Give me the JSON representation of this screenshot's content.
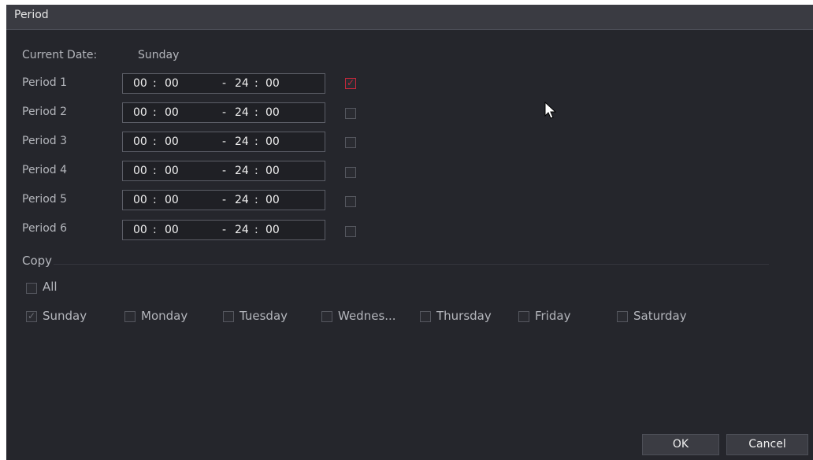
{
  "dialog": {
    "title": "Period"
  },
  "current_date": {
    "label": "Current Date:",
    "value": "Sunday"
  },
  "periods": [
    {
      "label": "Period 1",
      "start_h": "00",
      "start_m": "00",
      "end_h": "24",
      "end_m": "00",
      "enabled": true
    },
    {
      "label": "Period 2",
      "start_h": "00",
      "start_m": "00",
      "end_h": "24",
      "end_m": "00",
      "enabled": false
    },
    {
      "label": "Period 3",
      "start_h": "00",
      "start_m": "00",
      "end_h": "24",
      "end_m": "00",
      "enabled": false
    },
    {
      "label": "Period 4",
      "start_h": "00",
      "start_m": "00",
      "end_h": "24",
      "end_m": "00",
      "enabled": false
    },
    {
      "label": "Period 5",
      "start_h": "00",
      "start_m": "00",
      "end_h": "24",
      "end_m": "00",
      "enabled": false
    },
    {
      "label": "Period 6",
      "start_h": "00",
      "start_m": "00",
      "end_h": "24",
      "end_m": "00",
      "enabled": false
    }
  ],
  "copy": {
    "label": "Copy",
    "all_label": "All",
    "days": [
      {
        "label": "Sunday",
        "checked": true
      },
      {
        "label": "Monday",
        "checked": false
      },
      {
        "label": "Tuesday",
        "checked": false
      },
      {
        "label": "Wednes...",
        "checked": false
      },
      {
        "label": "Thursday",
        "checked": false
      },
      {
        "label": "Friday",
        "checked": false
      },
      {
        "label": "Saturday",
        "checked": false
      }
    ]
  },
  "buttons": {
    "ok": "OK",
    "cancel": "Cancel"
  },
  "colors": {
    "accent": "#c4283b",
    "background": "#25262c",
    "titlebar": "#3a3b42"
  }
}
